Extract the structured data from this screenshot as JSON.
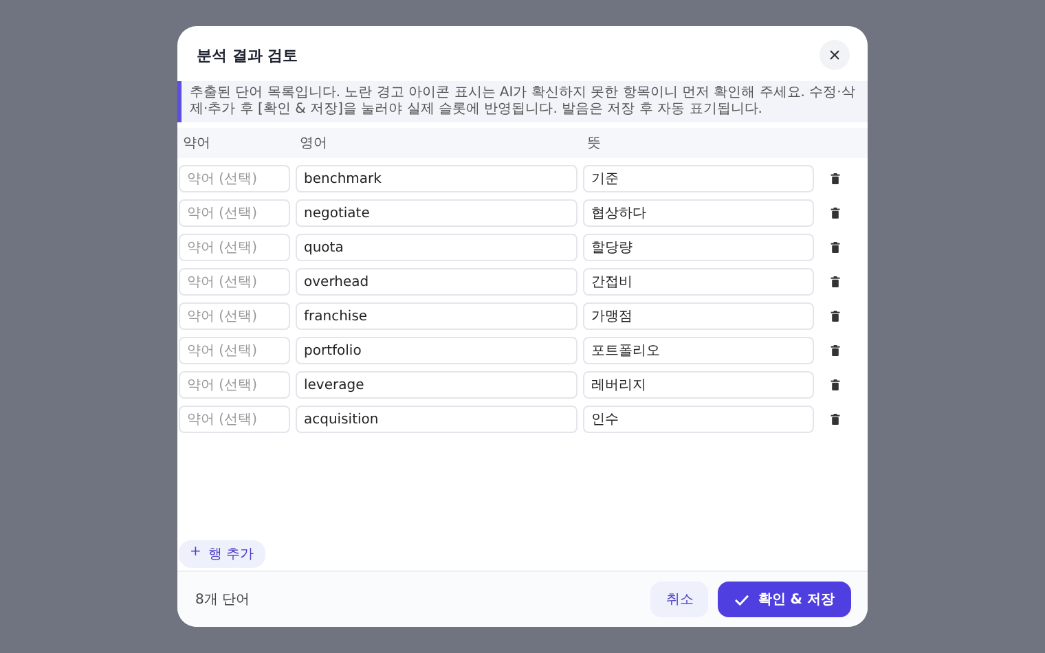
{
  "dialog": {
    "title": "분석 결과 검토",
    "close": "×",
    "notice": "추출된 단어 목록입니다. 노란 경고 아이콘 표시는 AI가 확신하지 못한 항목이니 먼저 확인해 주세요. 수정·삭제·추가 후 [확인 & 저장]을 눌러야 실제 슬롯에 반영됩니다. 발음은 저장 후 자동 표기됩니다."
  },
  "table": {
    "columns": [
      "약어",
      "영어",
      "뜻"
    ],
    "rows": [
      {
        "abbr_placeholder": "약어 (선택)",
        "word": "benchmark",
        "meaning": "기준"
      },
      {
        "abbr_placeholder": "약어 (선택)",
        "word": "negotiate",
        "meaning": "협상하다"
      },
      {
        "abbr_placeholder": "약어 (선택)",
        "word": "quota",
        "meaning": "할당량"
      },
      {
        "abbr_placeholder": "약어 (선택)",
        "word": "overhead",
        "meaning": "간접비"
      },
      {
        "abbr_placeholder": "약어 (선택)",
        "word": "franchise",
        "meaning": "가맹점"
      },
      {
        "abbr_placeholder": "약어 (선택)",
        "word": "portfolio",
        "meaning": "포트폴리오"
      },
      {
        "abbr_placeholder": "약어 (선택)",
        "word": "leverage",
        "meaning": "레버리지"
      },
      {
        "abbr_placeholder": "약어 (선택)",
        "word": "acquisition",
        "meaning": "인수"
      }
    ]
  },
  "add_row": {
    "icon": "+",
    "label": "행 추가"
  },
  "footer": {
    "count": "8개 단어",
    "cancel": "취소",
    "confirm": "확인 & 저장"
  }
}
